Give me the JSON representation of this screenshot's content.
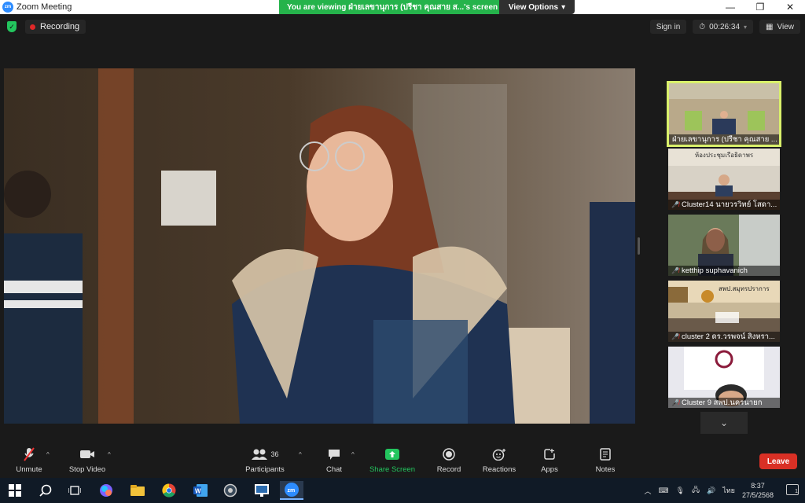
{
  "window": {
    "title": "Zoom Meeting",
    "app_icon_text": "zm",
    "minimize": "—",
    "maximize": "❐",
    "close": "✕"
  },
  "share_banner": {
    "text": "You are viewing ฝ่ายเลขานุการ (ปรีชา  คุณสาย  ส...'s screen",
    "view_options": "View Options",
    "caret": "▾"
  },
  "topbar": {
    "recording": "Recording",
    "sign_in": "Sign in",
    "timer": "00:26:34",
    "view": "View"
  },
  "thumbnails": [
    {
      "name": "ฝ่ายเลขานุการ (ปรีชา  คุณสาย ...",
      "muted": false,
      "active": true
    },
    {
      "name": "Cluster14 นายวรวิทย์ โสดา...",
      "muted": true,
      "active": false
    },
    {
      "name": "ketthip suphavanich",
      "muted": true,
      "active": false
    },
    {
      "name": "cluster 2 ดร.วรพจน์ สิงหรา...",
      "muted": true,
      "active": false
    },
    {
      "name": "Cluster 9 สพป.นครนายก",
      "muted": true,
      "active": false
    }
  ],
  "thumb_texts": {
    "room_sign": "ห้องประชุมเรือธิดาพร",
    "agency_sign": "สพป.สมุทรปราการ"
  },
  "toolbar": {
    "unmute": "Unmute",
    "stop_video": "Stop Video",
    "participants": "Participants",
    "participants_count": "36",
    "chat": "Chat",
    "share_screen": "Share Screen",
    "record": "Record",
    "reactions": "Reactions",
    "apps": "Apps",
    "notes": "Notes",
    "leave": "Leave"
  },
  "taskbar": {
    "lang": "ไทย",
    "time": "8:37",
    "date": "27/5/2568",
    "notif_count": "1"
  }
}
